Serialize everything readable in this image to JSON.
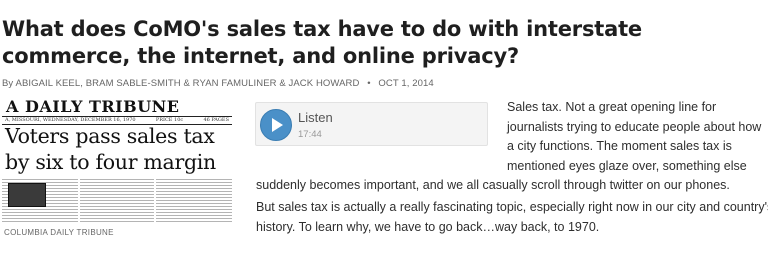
{
  "article": {
    "headline": "What does CoMO's sales tax have to do with interstate commerce, the internet, and online privacy?",
    "byline": {
      "prefix": "By",
      "authors": "ABIGAIL KEEL, BRAM SABLE-SMITH & RYAN FAMULINER & JACK HOWARD",
      "separator": "•",
      "date": "OCT 1, 2014"
    },
    "image": {
      "masthead": "A DAILY TRIBUNE",
      "dateline_left": "A, MISSOURI, WEDNESDAY, DECEMBER 16, 1970",
      "dateline_price": "PRICE 10c",
      "dateline_pages": "46 PAGES",
      "banner_line1": "Voters pass sales tax",
      "banner_line2": "by six to four margin",
      "credit": "COLUMBIA DAILY TRIBUNE"
    },
    "audio": {
      "label": "Listen",
      "duration": "17:44"
    },
    "paragraph1_lines": [
      "Sales tax. Not a great opening line for",
      "journalists trying to educate people about how",
      "a city functions. The moment sales tax is",
      "mentioned eyes glaze over, something else"
    ],
    "paragraph1_tail": "suddenly becomes important, and we all casually scroll through twitter on our phones.",
    "paragraph2_lines": [
      "But sales tax is actually a really fascinating topic, especially right now in our city and country's",
      "history. To learn why, we have to go back…way back, to 1970."
    ]
  },
  "colors": {
    "play_button": "#4a90c8",
    "headline": "#1f1f1f",
    "byline": "#666666"
  },
  "icons": {
    "play": "play-icon"
  }
}
